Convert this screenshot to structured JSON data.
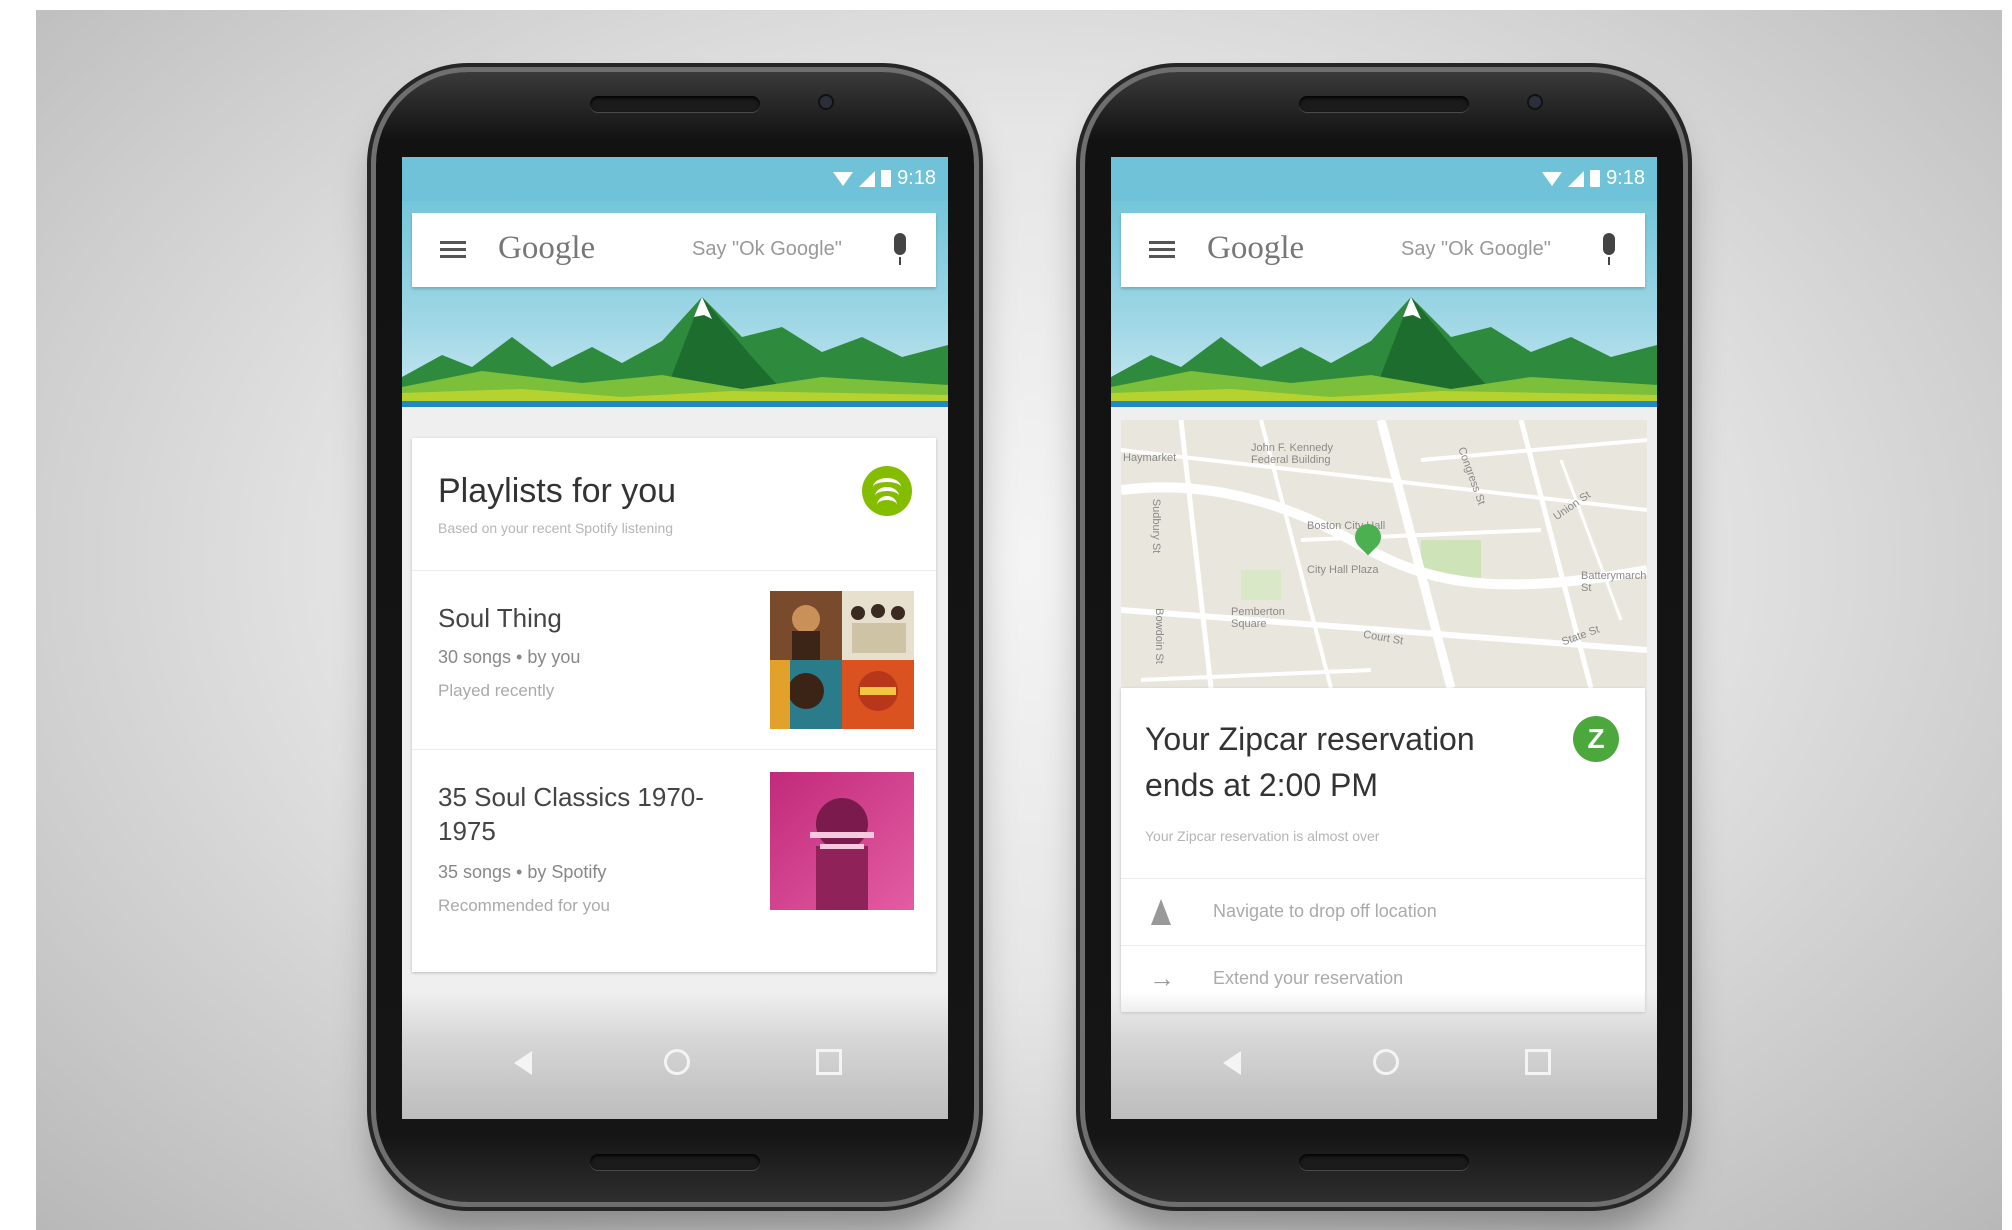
{
  "status_bar": {
    "time": "9:18"
  },
  "search": {
    "logo": "Google",
    "hint": "Say \"Ok Google\""
  },
  "colors": {
    "status_bar": "#6fc2d7",
    "spotify_green": "#84bd00",
    "zipcar_green": "#4ca83d",
    "lake_blue": "#1f88c9"
  },
  "icons": [
    "wifi-icon",
    "signal-icon",
    "battery-icon",
    "menu-icon",
    "mic-icon",
    "back-icon",
    "home-icon",
    "recents-icon",
    "spotify-icon",
    "zipcar-icon",
    "navigation-icon",
    "arrow-right-icon",
    "map-pin-icon"
  ],
  "phone1": {
    "card": {
      "title": "Playlists for you",
      "subtitle": "Based on your recent Spotify listening",
      "playlists": [
        {
          "name": "Soul Thing",
          "meta": "30 songs • by you",
          "note": "Played recently"
        },
        {
          "name": "35 Soul Classics 1970-1975",
          "meta": "35 songs • by Spotify",
          "note": "Recommended for you"
        }
      ]
    }
  },
  "phone2": {
    "map": {
      "labels": [
        "Haymarket",
        "John F. Kennedy Federal Building",
        "Boston City Hall",
        "City Hall Plaza",
        "Pemberton Square",
        "Sudbury St",
        "Congress St",
        "Court St",
        "State St",
        "Bowdoin St",
        "Union St",
        "Batterymarch St"
      ]
    },
    "card": {
      "title_line1": "Your Zipcar reservation",
      "title_line2": "ends at 2:00 PM",
      "subtitle": "Your Zipcar reservation is almost over",
      "actions": [
        "Navigate to drop off location",
        "Extend your reservation"
      ]
    }
  }
}
